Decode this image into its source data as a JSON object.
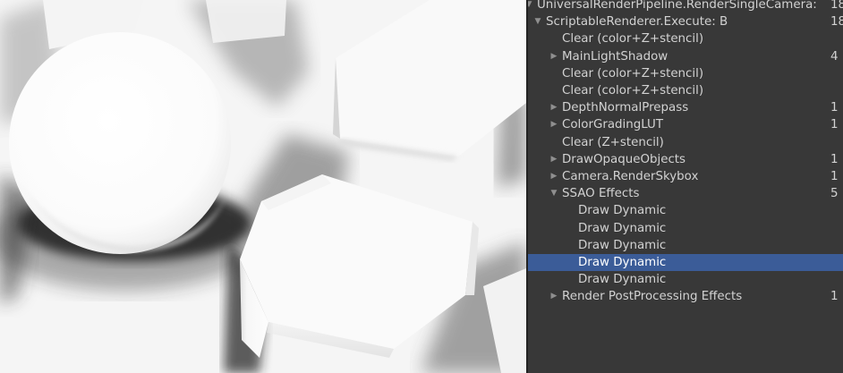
{
  "scene_view": {
    "description_icon": "ambient-occlusion-render"
  },
  "frame_debugger": {
    "events": [
      {
        "label": "UniversalRenderPipeline.RenderSingleCamera: ",
        "count": "18",
        "expanded": true,
        "has_children": true,
        "selected": false
      },
      {
        "label": "ScriptableRenderer.Execute: B",
        "count": "18",
        "expanded": true,
        "has_children": true,
        "selected": false
      },
      {
        "label": "Clear (color+Z+stencil)",
        "count": "",
        "expanded": false,
        "has_children": false,
        "selected": false
      },
      {
        "label": "MainLightShadow",
        "count": "4",
        "expanded": false,
        "has_children": true,
        "selected": false
      },
      {
        "label": "Clear (color+Z+stencil)",
        "count": "",
        "expanded": false,
        "has_children": false,
        "selected": false
      },
      {
        "label": "Clear (color+Z+stencil)",
        "count": "",
        "expanded": false,
        "has_children": false,
        "selected": false
      },
      {
        "label": "DepthNormalPrepass",
        "count": "1",
        "expanded": false,
        "has_children": true,
        "selected": false
      },
      {
        "label": "ColorGradingLUT",
        "count": "1",
        "expanded": false,
        "has_children": true,
        "selected": false
      },
      {
        "label": "Clear (Z+stencil)",
        "count": "",
        "expanded": false,
        "has_children": false,
        "selected": false
      },
      {
        "label": "DrawOpaqueObjects",
        "count": "1",
        "expanded": false,
        "has_children": true,
        "selected": false
      },
      {
        "label": "Camera.RenderSkybox",
        "count": "1",
        "expanded": false,
        "has_children": true,
        "selected": false
      },
      {
        "label": "SSAO Effects",
        "count": "5",
        "expanded": true,
        "has_children": true,
        "selected": false
      },
      {
        "label": "Draw Dynamic",
        "count": "",
        "expanded": false,
        "has_children": false,
        "selected": false
      },
      {
        "label": "Draw Dynamic",
        "count": "",
        "expanded": false,
        "has_children": false,
        "selected": false
      },
      {
        "label": "Draw Dynamic",
        "count": "",
        "expanded": false,
        "has_children": false,
        "selected": false
      },
      {
        "label": "Draw Dynamic",
        "count": "",
        "expanded": false,
        "has_children": false,
        "selected": true
      },
      {
        "label": "Draw Dynamic",
        "count": "",
        "expanded": false,
        "has_children": false,
        "selected": false
      },
      {
        "label": "Render PostProcessing Effects",
        "count": "1",
        "expanded": false,
        "has_children": true,
        "selected": false
      }
    ]
  },
  "colors": {
    "selection": "#3b5c98",
    "panel_bg": "#383838",
    "text": "#d2d2d2"
  }
}
